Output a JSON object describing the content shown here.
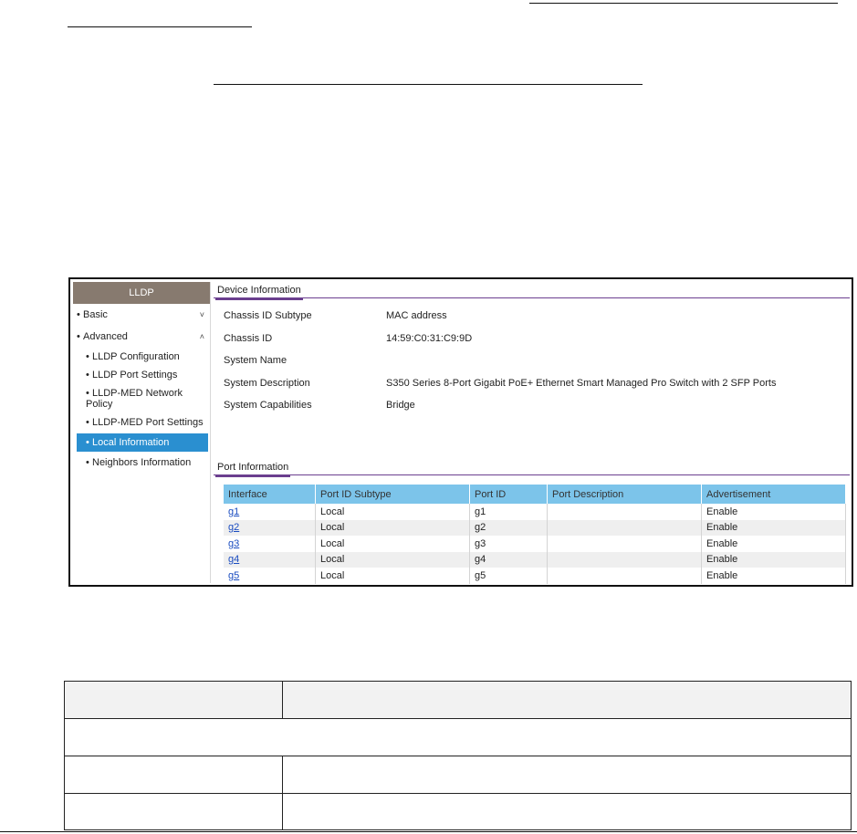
{
  "sidebar": {
    "header": "LLDP",
    "groups": [
      {
        "label": "Basic",
        "chevron": "˅"
      },
      {
        "label": "Advanced",
        "chevron": "˄"
      }
    ],
    "items": [
      {
        "label": "LLDP Configuration"
      },
      {
        "label": "LLDP Port Settings"
      },
      {
        "label": "LLDP-MED Network Policy"
      },
      {
        "label": "LLDP-MED Port Settings"
      },
      {
        "label": "Local Information",
        "active": true
      },
      {
        "label": "Neighbors Information"
      }
    ]
  },
  "device_info": {
    "title": "Device Information",
    "rows": [
      {
        "label": "Chassis ID Subtype",
        "value": "MAC address"
      },
      {
        "label": "Chassis ID",
        "value": "14:59:C0:31:C9:9D"
      },
      {
        "label": "System Name",
        "value": ""
      },
      {
        "label": "System Description",
        "value": "S350 Series 8-Port Gigabit PoE+ Ethernet Smart Managed Pro Switch with 2 SFP Ports"
      },
      {
        "label": "System Capabilities",
        "value": "Bridge"
      }
    ]
  },
  "port_info": {
    "title": "Port Information",
    "columns": [
      "Interface",
      "Port ID Subtype",
      "Port ID",
      "Port Description",
      "Advertisement"
    ],
    "rows": [
      [
        "g1",
        "Local",
        "g1",
        "",
        "Enable"
      ],
      [
        "g2",
        "Local",
        "g2",
        "",
        "Enable"
      ],
      [
        "g3",
        "Local",
        "g3",
        "",
        "Enable"
      ],
      [
        "g4",
        "Local",
        "g4",
        "",
        "Enable"
      ],
      [
        "g5",
        "Local",
        "g5",
        "",
        "Enable"
      ]
    ]
  },
  "colors": {
    "sidebar_header": "#877a6f",
    "active_item": "#2a8fd0",
    "table_header": "#7cc4ea",
    "section_underline": "#6b3f8f",
    "link": "#1a4cc0"
  }
}
